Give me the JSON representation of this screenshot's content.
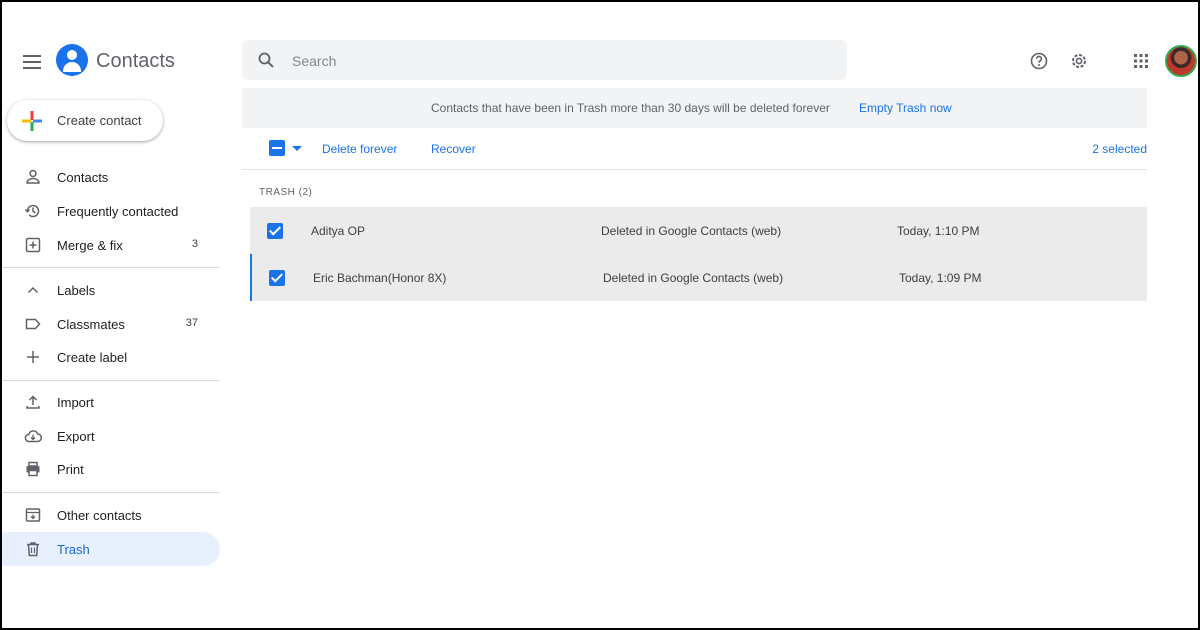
{
  "app": {
    "title": "Contacts",
    "brand_color": "#1a73e8"
  },
  "search": {
    "placeholder": "Search",
    "value": ""
  },
  "header_icons": [
    "menu-icon",
    "contacts-logo-icon",
    "search-icon",
    "help-icon",
    "settings-icon",
    "apps-grid-icon",
    "avatar"
  ],
  "sidebar": {
    "create_label": "Create contact",
    "items": [
      {
        "label": "Contacts",
        "icon": "person-icon",
        "count": ""
      },
      {
        "label": "Frequently contacted",
        "icon": "history-icon",
        "count": ""
      },
      {
        "label": "Merge & fix",
        "icon": "merge-icon",
        "count": "3"
      },
      {
        "label": "Labels",
        "icon": "chevron-up-icon",
        "count": ""
      },
      {
        "label": "Classmates",
        "icon": "label-icon",
        "count": "37"
      },
      {
        "label": "Create label",
        "icon": "plus-icon",
        "count": ""
      },
      {
        "label": "Import",
        "icon": "upload-icon",
        "count": ""
      },
      {
        "label": "Export",
        "icon": "cloud-download-icon",
        "count": ""
      },
      {
        "label": "Print",
        "icon": "printer-icon",
        "count": ""
      },
      {
        "label": "Other contacts",
        "icon": "archive-icon",
        "count": ""
      },
      {
        "label": "Trash",
        "icon": "trash-icon",
        "count": ""
      }
    ],
    "active_item": "Trash"
  },
  "banner": {
    "message": "Contacts that have been in Trash more than 30 days will be deleted forever",
    "action": "Empty Trash now"
  },
  "toolbar": {
    "delete_forever": "Delete forever",
    "recover": "Recover",
    "selected_count": "2 selected"
  },
  "list": {
    "section_title": "TRASH (2)",
    "rows": [
      {
        "name": "Aditya OP",
        "source": "Deleted in Google Contacts (web)",
        "time": "Today, 1:10 PM",
        "checked": true
      },
      {
        "name": "Eric Bachman(Honor 8X)",
        "source": "Deleted in Google Contacts (web)",
        "time": "Today, 1:09 PM",
        "checked": true
      }
    ]
  }
}
